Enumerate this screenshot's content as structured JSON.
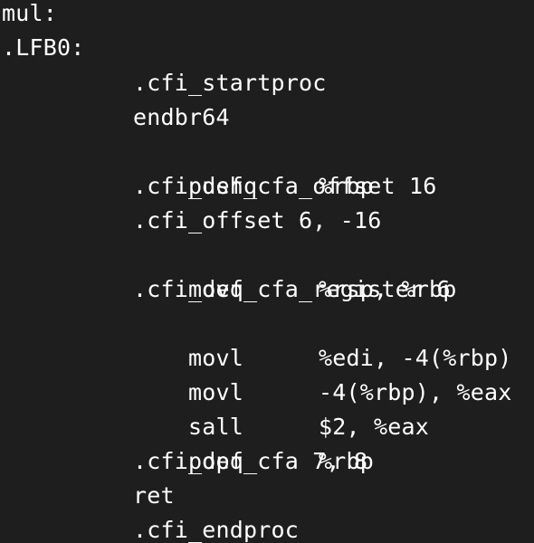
{
  "code": {
    "labels": {
      "function": "mul:",
      "block": ".LFB0:"
    },
    "lines": [
      {
        "text": ".cfi_startproc"
      },
      {
        "text": "endbr64"
      },
      {
        "mnemonic": "pushq",
        "operands": "%rbp"
      },
      {
        "text": ".cfi_def_cfa_offset 16"
      },
      {
        "text": ".cfi_offset 6, -16"
      },
      {
        "mnemonic": "movq",
        "operands": "%rsp, %rbp"
      },
      {
        "text": ".cfi_def_cfa_register 6"
      },
      {
        "mnemonic": "movl",
        "operands": "%edi, -4(%rbp)"
      },
      {
        "mnemonic": "movl",
        "operands": "-4(%rbp), %eax"
      },
      {
        "mnemonic": "sall",
        "operands": "$2, %eax"
      },
      {
        "mnemonic": "popq",
        "operands": "%rbp"
      },
      {
        "text": ".cfi_def_cfa 7, 8"
      },
      {
        "text": "ret"
      },
      {
        "text": ".cfi_endproc"
      }
    ]
  },
  "colors": {
    "background": "#1e1e1e",
    "text": "#ffffff"
  }
}
